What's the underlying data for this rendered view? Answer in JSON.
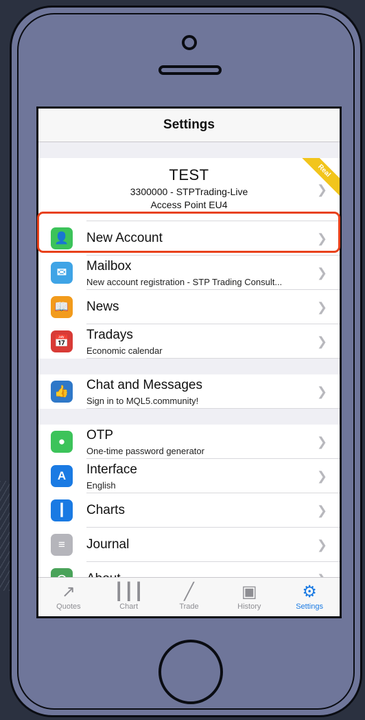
{
  "header": {
    "title": "Settings"
  },
  "account": {
    "name": "TEST",
    "server": "3300000 - STPTrading-Live",
    "access_point": "Access Point EU4",
    "badge": "Real"
  },
  "groups": [
    [
      {
        "title": "New Account",
        "subtitle": "",
        "icon": "add-user-icon",
        "color": "#3cc35a"
      },
      {
        "title": "Mailbox",
        "subtitle": "New account registration - STP Trading Consult...",
        "icon": "mail-icon",
        "color": "#3fa4e6"
      },
      {
        "title": "News",
        "subtitle": "",
        "icon": "book-icon",
        "color": "#f29b1c"
      },
      {
        "title": "Tradays",
        "subtitle": "Economic calendar",
        "icon": "calendar-icon",
        "color": "#d83b36"
      }
    ],
    [
      {
        "title": "Chat and Messages",
        "subtitle": "Sign in to MQL5.community!",
        "icon": "thumbs-up-icon",
        "color": "#2f78c8"
      }
    ],
    [
      {
        "title": "OTP",
        "subtitle": "One-time password generator",
        "icon": "keyhole-icon",
        "color": "#3cc35a"
      },
      {
        "title": "Interface",
        "subtitle": "English",
        "icon": "translate-icon",
        "color": "#1a7ae3"
      },
      {
        "title": "Charts",
        "subtitle": "",
        "icon": "candlestick-icon",
        "color": "#1a7ae3"
      },
      {
        "title": "Journal",
        "subtitle": "",
        "icon": "document-icon",
        "color": "#b5b5bb"
      },
      {
        "title": "About",
        "subtitle": "",
        "icon": "globe-icon",
        "color": "#4aa35a"
      }
    ]
  ],
  "tabs": [
    {
      "label": "Quotes",
      "icon": "quotes-arrows-icon",
      "active": false
    },
    {
      "label": "Chart",
      "icon": "chart-candles-icon",
      "active": false
    },
    {
      "label": "Trade",
      "icon": "trade-line-icon",
      "active": false
    },
    {
      "label": "History",
      "icon": "inbox-icon",
      "active": false
    },
    {
      "label": "Settings",
      "icon": "gear-icon",
      "active": true
    }
  ],
  "colors": {
    "accent": "#1a7ae3",
    "highlight": "#e8411b",
    "badge": "#f2c51c"
  }
}
